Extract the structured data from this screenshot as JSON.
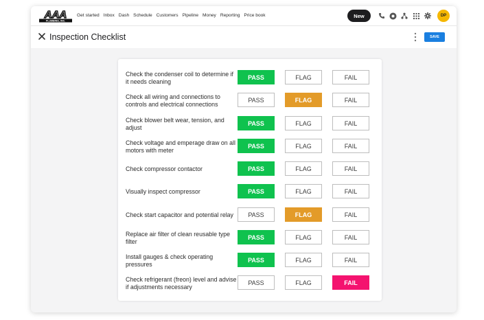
{
  "app": {
    "logo_text": "AAA",
    "logo_subtext": "PLUMBING, INC."
  },
  "nav": {
    "items": [
      "Get started",
      "Inbox",
      "Dash",
      "Schedule",
      "Customers",
      "Pipeline",
      "Money",
      "Reporting",
      "Price book"
    ]
  },
  "toolbar": {
    "new_label": "New",
    "avatar_initials": "DP",
    "icons": [
      "phone-icon",
      "headset-icon",
      "network-icon",
      "grid-icon",
      "gear-icon"
    ]
  },
  "header": {
    "title": "Inspection Checklist",
    "save_label": "SAVE"
  },
  "colors": {
    "pass": "#0fc24e",
    "flag": "#e39b29",
    "fail": "#f4136f",
    "save": "#1a7fe0",
    "avatar": "#f5b700"
  },
  "option_labels": {
    "pass": "PASS",
    "flag": "FLAG",
    "fail": "FAIL"
  },
  "checklist": [
    {
      "text": "Check the condenser coil to determine if it needs cleaning",
      "selected": "pass"
    },
    {
      "text": "Check all wiring and connections to controls and electrical connections",
      "selected": "flag"
    },
    {
      "text": "Check blower belt wear, tension, and adjust",
      "selected": "pass"
    },
    {
      "text": "Check voltage and emperage draw on all motors with meter",
      "selected": "pass"
    },
    {
      "text": "Check compressor contactor",
      "selected": "pass"
    },
    {
      "text": "Visually inspect compressor",
      "selected": "pass"
    },
    {
      "text": "Check start capacitor and potential relay",
      "selected": "flag"
    },
    {
      "text": "Replace air filter of clean reusable type filter",
      "selected": "pass"
    },
    {
      "text": "Install gauges & check operating pressures",
      "selected": "pass"
    },
    {
      "text": "Check refrigerant (freon) level and advise if adjustments necessary",
      "selected": "fail"
    }
  ]
}
